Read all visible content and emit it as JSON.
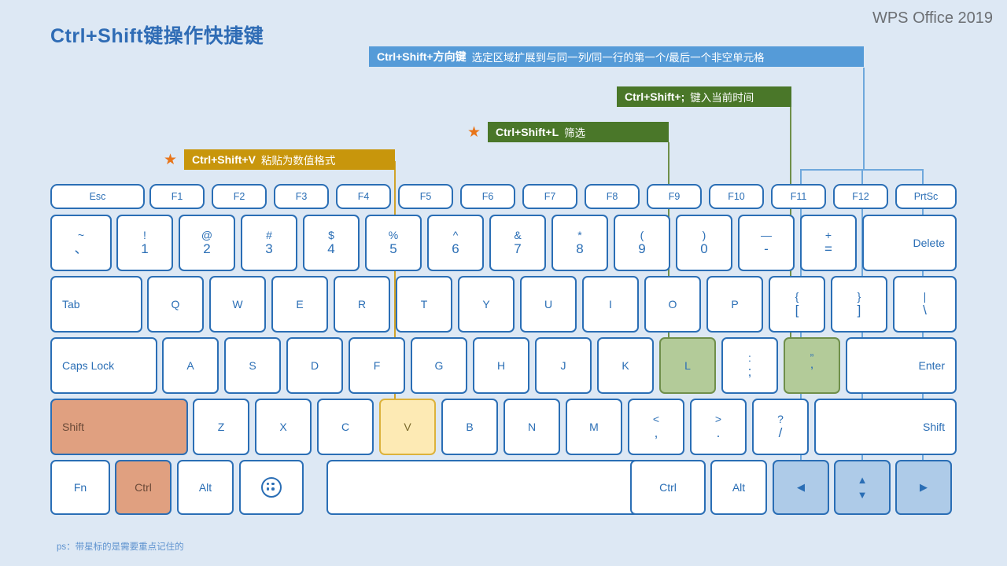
{
  "header": {
    "title": "Ctrl+Shift键操作快捷键",
    "brand": "WPS Office 2019"
  },
  "footnote": "ps：带星标的是需要重点记住的",
  "callouts": [
    {
      "id": "arrow-keys",
      "combo": "Ctrl+Shift+方向键",
      "desc": "选定区域扩展到与同一列/同一行的第一个/最后一个非空单元格",
      "color": "#559bd8",
      "starred": false
    },
    {
      "id": "semicolon",
      "combo": "Ctrl+Shift+;",
      "desc": "键入当前时间",
      "color": "#4a7729",
      "starred": false
    },
    {
      "id": "filter",
      "combo": "Ctrl+Shift+L",
      "desc": "筛选",
      "color": "#4a7729",
      "starred": true
    },
    {
      "id": "paste-value",
      "combo": "Ctrl+Shift+V",
      "desc": "粘贴为数值格式",
      "color": "#c8960c",
      "starred": true
    }
  ],
  "star_glyph": "★",
  "keyboard": {
    "function_row": [
      {
        "label": "Esc"
      },
      {
        "label": "F1"
      },
      {
        "label": "F2"
      },
      {
        "label": "F3"
      },
      {
        "label": "F4"
      },
      {
        "label": "F5"
      },
      {
        "label": "F6"
      },
      {
        "label": "F7"
      },
      {
        "label": "F8"
      },
      {
        "label": "F9"
      },
      {
        "label": "F10"
      },
      {
        "label": "F11"
      },
      {
        "label": "F12"
      },
      {
        "label": "PrtSc"
      }
    ],
    "number_row": [
      {
        "upper": "~",
        "lower": "、"
      },
      {
        "upper": "!",
        "lower": "1"
      },
      {
        "upper": "@",
        "lower": "2"
      },
      {
        "upper": "#",
        "lower": "3"
      },
      {
        "upper": "$",
        "lower": "4"
      },
      {
        "upper": "%",
        "lower": "5"
      },
      {
        "upper": "^",
        "lower": "6"
      },
      {
        "upper": "&",
        "lower": "7"
      },
      {
        "upper": "*",
        "lower": "8"
      },
      {
        "upper": "(",
        "lower": "9"
      },
      {
        "upper": ")",
        "lower": "0"
      },
      {
        "upper": "—",
        "lower": "-"
      },
      {
        "upper": "+",
        "lower": "="
      },
      {
        "label": "Delete"
      }
    ],
    "tab_row": [
      {
        "label": "Tab"
      },
      {
        "label": "Q"
      },
      {
        "label": "W"
      },
      {
        "label": "E"
      },
      {
        "label": "R"
      },
      {
        "label": "T"
      },
      {
        "label": "Y"
      },
      {
        "label": "U"
      },
      {
        "label": "I"
      },
      {
        "label": "O"
      },
      {
        "label": "P"
      },
      {
        "upper": "{",
        "lower": "["
      },
      {
        "upper": "}",
        "lower": "]"
      },
      {
        "upper": "|",
        "lower": "\\"
      }
    ],
    "home_row": [
      {
        "label": "Caps Lock"
      },
      {
        "label": "A"
      },
      {
        "label": "S"
      },
      {
        "label": "D"
      },
      {
        "label": "F"
      },
      {
        "label": "G"
      },
      {
        "label": "H"
      },
      {
        "label": "J"
      },
      {
        "label": "K"
      },
      {
        "label": "L",
        "highlight": "green"
      },
      {
        "upper": ":",
        "lower": ";"
      },
      {
        "upper": "”",
        "lower": "’",
        "highlight": "green"
      },
      {
        "label": "Enter"
      }
    ],
    "shift_row": [
      {
        "label": "Shift",
        "highlight": "salmon"
      },
      {
        "label": "Z"
      },
      {
        "label": "X"
      },
      {
        "label": "C"
      },
      {
        "label": "V",
        "highlight": "gold"
      },
      {
        "label": "B"
      },
      {
        "label": "N"
      },
      {
        "label": "M"
      },
      {
        "upper": "<",
        "lower": ","
      },
      {
        "upper": ">",
        "lower": "."
      },
      {
        "upper": "?",
        "lower": "/"
      },
      {
        "label": "Shift"
      }
    ],
    "bottom_row": [
      {
        "label": "Fn"
      },
      {
        "label": "Ctrl",
        "highlight": "salmon"
      },
      {
        "label": "Alt"
      },
      {
        "label": "",
        "icon": "windows-icon"
      },
      {
        "label": ""
      },
      {
        "label": "Ctrl"
      },
      {
        "label": "Alt"
      },
      {
        "label": "◄",
        "icon": "arrow-left-icon",
        "highlight": "blue"
      },
      {
        "label": "▲▼",
        "icon": "arrow-up-down-icon",
        "highlight": "blue"
      },
      {
        "label": "►",
        "icon": "arrow-right-icon",
        "highlight": "blue"
      }
    ]
  },
  "colors": {
    "background": "#dde8f4",
    "key_border": "#2a6eb5",
    "accent_blue": "#559bd8",
    "accent_green": "#4a7729",
    "accent_gold": "#c8960c",
    "title": "#2f6cb5"
  }
}
